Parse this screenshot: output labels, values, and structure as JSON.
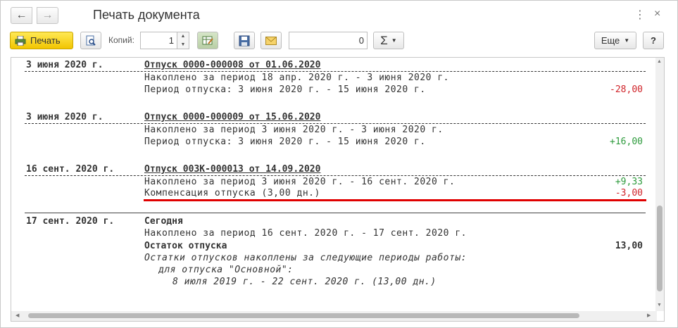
{
  "window": {
    "title": "Печать документа",
    "back_glyph": "←",
    "forward_glyph": "→",
    "more_glyph": "⋮",
    "close_glyph": "×"
  },
  "toolbar": {
    "print_label": "Печать",
    "copies_label": "Копий:",
    "copies_value": "1",
    "sum_value": "0",
    "sigma_label": "Σ",
    "more_label": "Еще",
    "help_label": "?"
  },
  "entries": [
    {
      "date": "3 июня 2020 г.",
      "doc": "Отпуск 0000-000008 от 01.06.2020",
      "lines": [
        {
          "text": "Накоплено за период 18 апр. 2020 г. - 3 июня 2020 г.",
          "amount": ""
        },
        {
          "text": "Период отпуска: 3 июня 2020 г. - 15 июня 2020 г.",
          "amount": "-28,00"
        }
      ]
    },
    {
      "date": "3 июня 2020 г.",
      "doc": "Отпуск 0000-000009 от 15.06.2020",
      "lines": [
        {
          "text": "Накоплено за период 3 июня 2020 г. - 3 июня 2020 г.",
          "amount": ""
        },
        {
          "text": "Период отпуска: 3 июня 2020 г. - 15 июня 2020 г.",
          "amount": "+16,00"
        }
      ]
    },
    {
      "date": "16 сент. 2020 г.",
      "doc": "Отпуск 003К-000013 от 14.09.2020",
      "lines": [
        {
          "text": "Накоплено за период 3 июня 2020 г. - 16 сент. 2020 г.",
          "amount": "+9,33"
        },
        {
          "text": "Компенсация отпуска (3,00 дн.)",
          "amount": "-3,00"
        }
      ]
    }
  ],
  "today": {
    "date": "17 сент. 2020 г.",
    "label": "Сегодня",
    "accrued": "Накоплено за период 16 сент. 2020 г. - 17 сент. 2020 г.",
    "balance_label": "Остаток отпуска",
    "balance_value": "13,00",
    "note1": "Остатки отпусков накоплены за следующие периоды работы:",
    "note2": "для отпуска \"Основной\":",
    "note3": "8 июля 2019 г. - 22 сент. 2020 г. (13,00 дн.)"
  },
  "colors": {
    "negative": "#d0242a",
    "positive": "#2c9a3b",
    "highlight_underline": "#e00000",
    "print_button": "#f2c500"
  }
}
